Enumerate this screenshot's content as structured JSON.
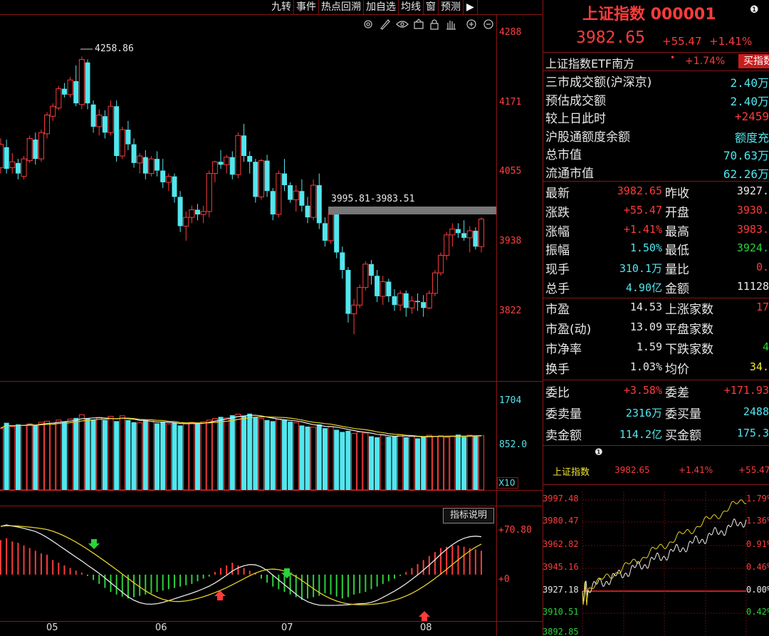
{
  "menu": [
    "九转",
    "事件",
    "热点回溯",
    "加自选",
    "均线",
    "窗",
    "预测"
  ],
  "menu_arrow": "▶",
  "toolbar_icons": [
    "settings-icon",
    "pen-icon",
    "eye-icon",
    "basket-icon",
    "lock-icon",
    "hand-icon",
    "zoom-in-icon",
    "zoom-out-icon"
  ],
  "header": {
    "title": "上证指数 000001",
    "price": "3982.65",
    "change": "+55.47",
    "pct": "+1.41%",
    "info_icon": "❶"
  },
  "etf": {
    "name": "上证指数ETF南方",
    "dot": "•",
    "pct": "+1.74%",
    "buy_label": "买指数"
  },
  "stats_top": [
    {
      "label": "三市成交额(沪深京)",
      "value": "2.40万"
    },
    {
      "label": "预估成交额",
      "value": "2.40万"
    },
    {
      "label": "较上日此时",
      "value": "+2459"
    },
    {
      "label": "沪股通额度余额",
      "value": "额度充"
    },
    {
      "label": "总市值",
      "value": "70.63万"
    },
    {
      "label": "流通市值",
      "value": "62.26万"
    }
  ],
  "quote_rows": [
    {
      "l1": "最新",
      "v1": "3982.65",
      "l2": "昨收",
      "v2": "3927."
    },
    {
      "l1": "涨跌",
      "v1": "+55.47",
      "l2": "开盘",
      "v2": "3930."
    },
    {
      "l1": "涨幅",
      "v1": "+1.41%",
      "l2": "最高",
      "v2": "3983."
    },
    {
      "l1": "振幅",
      "v1": "1.50%",
      "l2": "最低",
      "v2": "3924."
    },
    {
      "l1": "现手",
      "v1": "310.1万",
      "l2": "量比",
      "v2": "0."
    },
    {
      "l1": "总手",
      "v1": "4.90亿",
      "l2": "金额",
      "v2": "11128"
    }
  ],
  "market_rows": [
    {
      "l1": "市盈",
      "v1": "14.53",
      "l2": "上涨家数",
      "v2": "17"
    },
    {
      "l1": "市盈(动)",
      "v1": "13.09",
      "l2": "平盘家数",
      "v2": ""
    },
    {
      "l1": "市净率",
      "v1": "1.59",
      "l2": "下跌家数",
      "v2": "4"
    },
    {
      "l1": "换手",
      "v1": "1.03%",
      "l2": "均价",
      "v2": "34."
    }
  ],
  "order_rows": [
    {
      "l1": "委比",
      "v1": "+3.58%",
      "l2": "委差",
      "v2": "+171.93"
    },
    {
      "l1": "委卖量",
      "v1": "2316万",
      "l2": "委买量",
      "v2": "2488"
    },
    {
      "l1": "卖金额",
      "v1": "114.2亿",
      "l2": "买金额",
      "v2": "175.3"
    }
  ],
  "mini": {
    "name": "上证指数",
    "price": "3982.65",
    "pct": "+1.41%",
    "change": "+55.47",
    "left_axis": [
      "3997.48",
      "3980.47",
      "3962.82",
      "3945.16",
      "3927.18",
      "3910.51",
      "3892.85"
    ],
    "right_axis": [
      "1.79%",
      "1.36%",
      "0.91%",
      "0.46%",
      "0.00%",
      "0.42%"
    ]
  },
  "kline": {
    "price_axis": [
      "4288",
      "4171",
      "4055",
      "3938",
      "3822"
    ],
    "high_label": "4258.86",
    "zone_label": "3995.81-3983.51",
    "months": [
      "05",
      "06",
      "07",
      "08"
    ]
  },
  "volume": {
    "axis": [
      "1704",
      "852.0"
    ],
    "unit": "X10"
  },
  "macd": {
    "button": "指标说明",
    "axis": [
      "+70.80",
      "+0"
    ]
  },
  "chart_data": [
    {
      "type": "candlestick",
      "title": "",
      "x": [
        "05",
        "06",
        "07",
        "08"
      ],
      "ylim": [
        3705,
        4330
      ],
      "ticks": [
        4288,
        4171,
        4055,
        3938,
        3822
      ],
      "annotations": [
        "4258.86",
        "3995.81-3983.51"
      ],
      "series": [
        {
          "ohlc": [
            [
              4070,
              4120,
              4060,
              4110
            ],
            [
              4105,
              4118,
              4060,
              4068
            ],
            [
              4070,
              4095,
              4060,
              4080
            ],
            [
              4078,
              4085,
              4050,
              4060
            ],
            [
              4055,
              4090,
              4050,
              4085
            ],
            [
              4082,
              4125,
              4078,
              4120
            ],
            [
              4118,
              4130,
              4075,
              4085
            ],
            [
              4085,
              4135,
              4080,
              4130
            ],
            [
              4128,
              4165,
              4120,
              4160
            ],
            [
              4158,
              4180,
              4150,
              4175
            ],
            [
              4172,
              4210,
              4168,
              4205
            ],
            [
              4205,
              4215,
              4190,
              4195
            ],
            [
              4195,
              4225,
              4190,
              4220
            ],
            [
              4218,
              4245,
              4175,
              4180
            ],
            [
              4178,
              4260,
              4170,
              4255
            ],
            [
              4250,
              4255,
              4170,
              4180
            ],
            [
              4178,
              4185,
              4130,
              4140
            ],
            [
              4140,
              4170,
              4125,
              4160
            ],
            [
              4158,
              4168,
              4120,
              4130
            ],
            [
              4130,
              4185,
              4125,
              4175
            ],
            [
              4175,
              4185,
              4080,
              4090
            ],
            [
              4090,
              4140,
              4085,
              4135
            ],
            [
              4135,
              4150,
              4100,
              4110
            ],
            [
              4110,
              4120,
              4070,
              4078
            ],
            [
              4078,
              4095,
              4060,
              4090
            ],
            [
              4088,
              4100,
              4050,
              4060
            ],
            [
              4060,
              4090,
              4055,
              4085
            ],
            [
              4085,
              4098,
              4055,
              4065
            ],
            [
              4065,
              4085,
              4035,
              4045
            ],
            [
              4045,
              4060,
              4030,
              4055
            ],
            [
              4055,
              4060,
              4010,
              4020
            ],
            [
              4020,
              4030,
              3960,
              3970
            ],
            [
              3970,
              3995,
              3945,
              3985
            ],
            [
              3985,
              4005,
              3975,
              3998
            ],
            [
              3998,
              4008,
              3980,
              3990
            ],
            [
              3990,
              4005,
              3975,
              3995
            ],
            [
              3995,
              4065,
              3985,
              4060
            ],
            [
              4060,
              4082,
              4045,
              4080
            ],
            [
              4080,
              4100,
              4068,
              4075
            ],
            [
              4075,
              4092,
              4060,
              4088
            ],
            [
              4088,
              4098,
              4050,
              4058
            ],
            [
              4058,
              4130,
              4052,
              4125
            ],
            [
              4125,
              4145,
              4080,
              4090
            ],
            [
              4090,
              4098,
              4060,
              4080
            ],
            [
              4080,
              4085,
              4010,
              4020
            ],
            [
              4020,
              4085,
              4015,
              4082
            ],
            [
              4082,
              4092,
              4020,
              4030
            ],
            [
              4030,
              4035,
              3980,
              3990
            ],
            [
              3990,
              4065,
              3985,
              4060
            ],
            [
              4060,
              4085,
              4030,
              4040
            ],
            [
              4040,
              4045,
              4010,
              4015
            ],
            [
              4015,
              4040,
              3995,
              4030
            ],
            [
              4030,
              4050,
              3995,
              4005
            ],
            [
              4005,
              4020,
              3975,
              3985
            ],
            [
              3985,
              4050,
              3980,
              4040
            ],
            [
              4040,
              4060,
              3965,
              3975
            ],
            [
              3975,
              3985,
              3935,
              3945
            ],
            [
              3945,
              3995,
              3940,
              3990
            ],
            [
              3990,
              3995,
              3915,
              3925
            ],
            [
              3925,
              3935,
              3880,
              3895
            ],
            [
              3895,
              3900,
              3805,
              3820
            ],
            [
              3820,
              3845,
              3785,
              3835
            ],
            [
              3835,
              3870,
              3830,
              3865
            ],
            [
              3865,
              3910,
              3860,
              3905
            ],
            [
              3905,
              3912,
              3870,
              3885
            ],
            [
              3885,
              3895,
              3840,
              3850
            ],
            [
              3850,
              3885,
              3835,
              3875
            ],
            [
              3875,
              3880,
              3840,
              3850
            ],
            [
              3850,
              3862,
              3825,
              3835
            ],
            [
              3835,
              3860,
              3825,
              3855
            ],
            [
              3855,
              3860,
              3815,
              3830
            ],
            [
              3830,
              3850,
              3820,
              3842
            ],
            [
              3842,
              3855,
              3825,
              3840
            ],
            [
              3840,
              3852,
              3815,
              3830
            ],
            [
              3830,
              3860,
              3828,
              3855
            ],
            [
              3855,
              3895,
              3850,
              3890
            ],
            [
              3890,
              3925,
              3885,
              3920
            ],
            [
              3920,
              3960,
              3912,
              3955
            ],
            [
              3955,
              3975,
              3935,
              3965
            ],
            [
              3965,
              3975,
              3950,
              3958
            ],
            [
              3958,
              3980,
              3945,
              3950
            ],
            [
              3950,
              3970,
              3925,
              3962
            ],
            [
              3962,
              3968,
              3930,
              3935
            ],
            [
              3935,
              3985,
              3925,
              3982
            ]
          ]
        }
      ]
    },
    {
      "type": "bar",
      "title": "",
      "ylim": [
        0,
        2000
      ],
      "ticks": [
        1704,
        852
      ],
      "series": [
        {
          "values": [
            1150,
            1250,
            1180,
            1220,
            1200,
            1230,
            1210,
            1260,
            1280,
            1240,
            1300,
            1270,
            1320,
            1340,
            1400,
            1330,
            1310,
            1350,
            1300,
            1370,
            1280,
            1380,
            1300,
            1260,
            1250,
            1290,
            1280,
            1240,
            1260,
            1230,
            1250,
            1200,
            1230,
            1260,
            1240,
            1270,
            1300,
            1330,
            1360,
            1340,
            1390,
            1410,
            1380,
            1420,
            1350,
            1330,
            1300,
            1280,
            1320,
            1300,
            1270,
            1250,
            1200,
            1180,
            1170,
            1220,
            1150,
            1180,
            1120,
            1080,
            1100,
            1050,
            1080,
            1060,
            1000,
            980,
            1020,
            990,
            1000,
            1030,
            980,
            1000,
            960,
            990,
            1020,
            1000,
            1010,
            980,
            1000,
            1030,
            990,
            1020,
            1000,
            1010
          ]
        }
      ]
    },
    {
      "type": "bar",
      "title": "",
      "ylim": [
        -70,
        75
      ],
      "ticks": [
        70.8,
        0
      ],
      "series": [
        {
          "values": [
            52,
            55,
            50,
            48,
            44,
            40,
            36,
            32,
            30,
            22,
            18,
            14,
            10,
            6,
            3,
            -2,
            -8,
            -14,
            -20,
            -26,
            -30,
            -33,
            -36,
            -34,
            -32,
            -30,
            -28,
            -26,
            -24,
            -22,
            -20,
            -18,
            -16,
            -14,
            -10,
            -6,
            -3,
            4,
            10,
            14,
            18,
            14,
            10,
            6,
            2,
            -6,
            -12,
            -18,
            -22,
            -26,
            -30,
            -34,
            -38,
            -36,
            -34,
            -32,
            -28,
            -30,
            -33,
            -36,
            -34,
            -30,
            -28,
            -26,
            -22,
            -18,
            -14,
            -10,
            -6,
            -2,
            4,
            10,
            16,
            22,
            28,
            34,
            40,
            42,
            44,
            44,
            42,
            40,
            38,
            36
          ]
        }
      ]
    }
  ]
}
